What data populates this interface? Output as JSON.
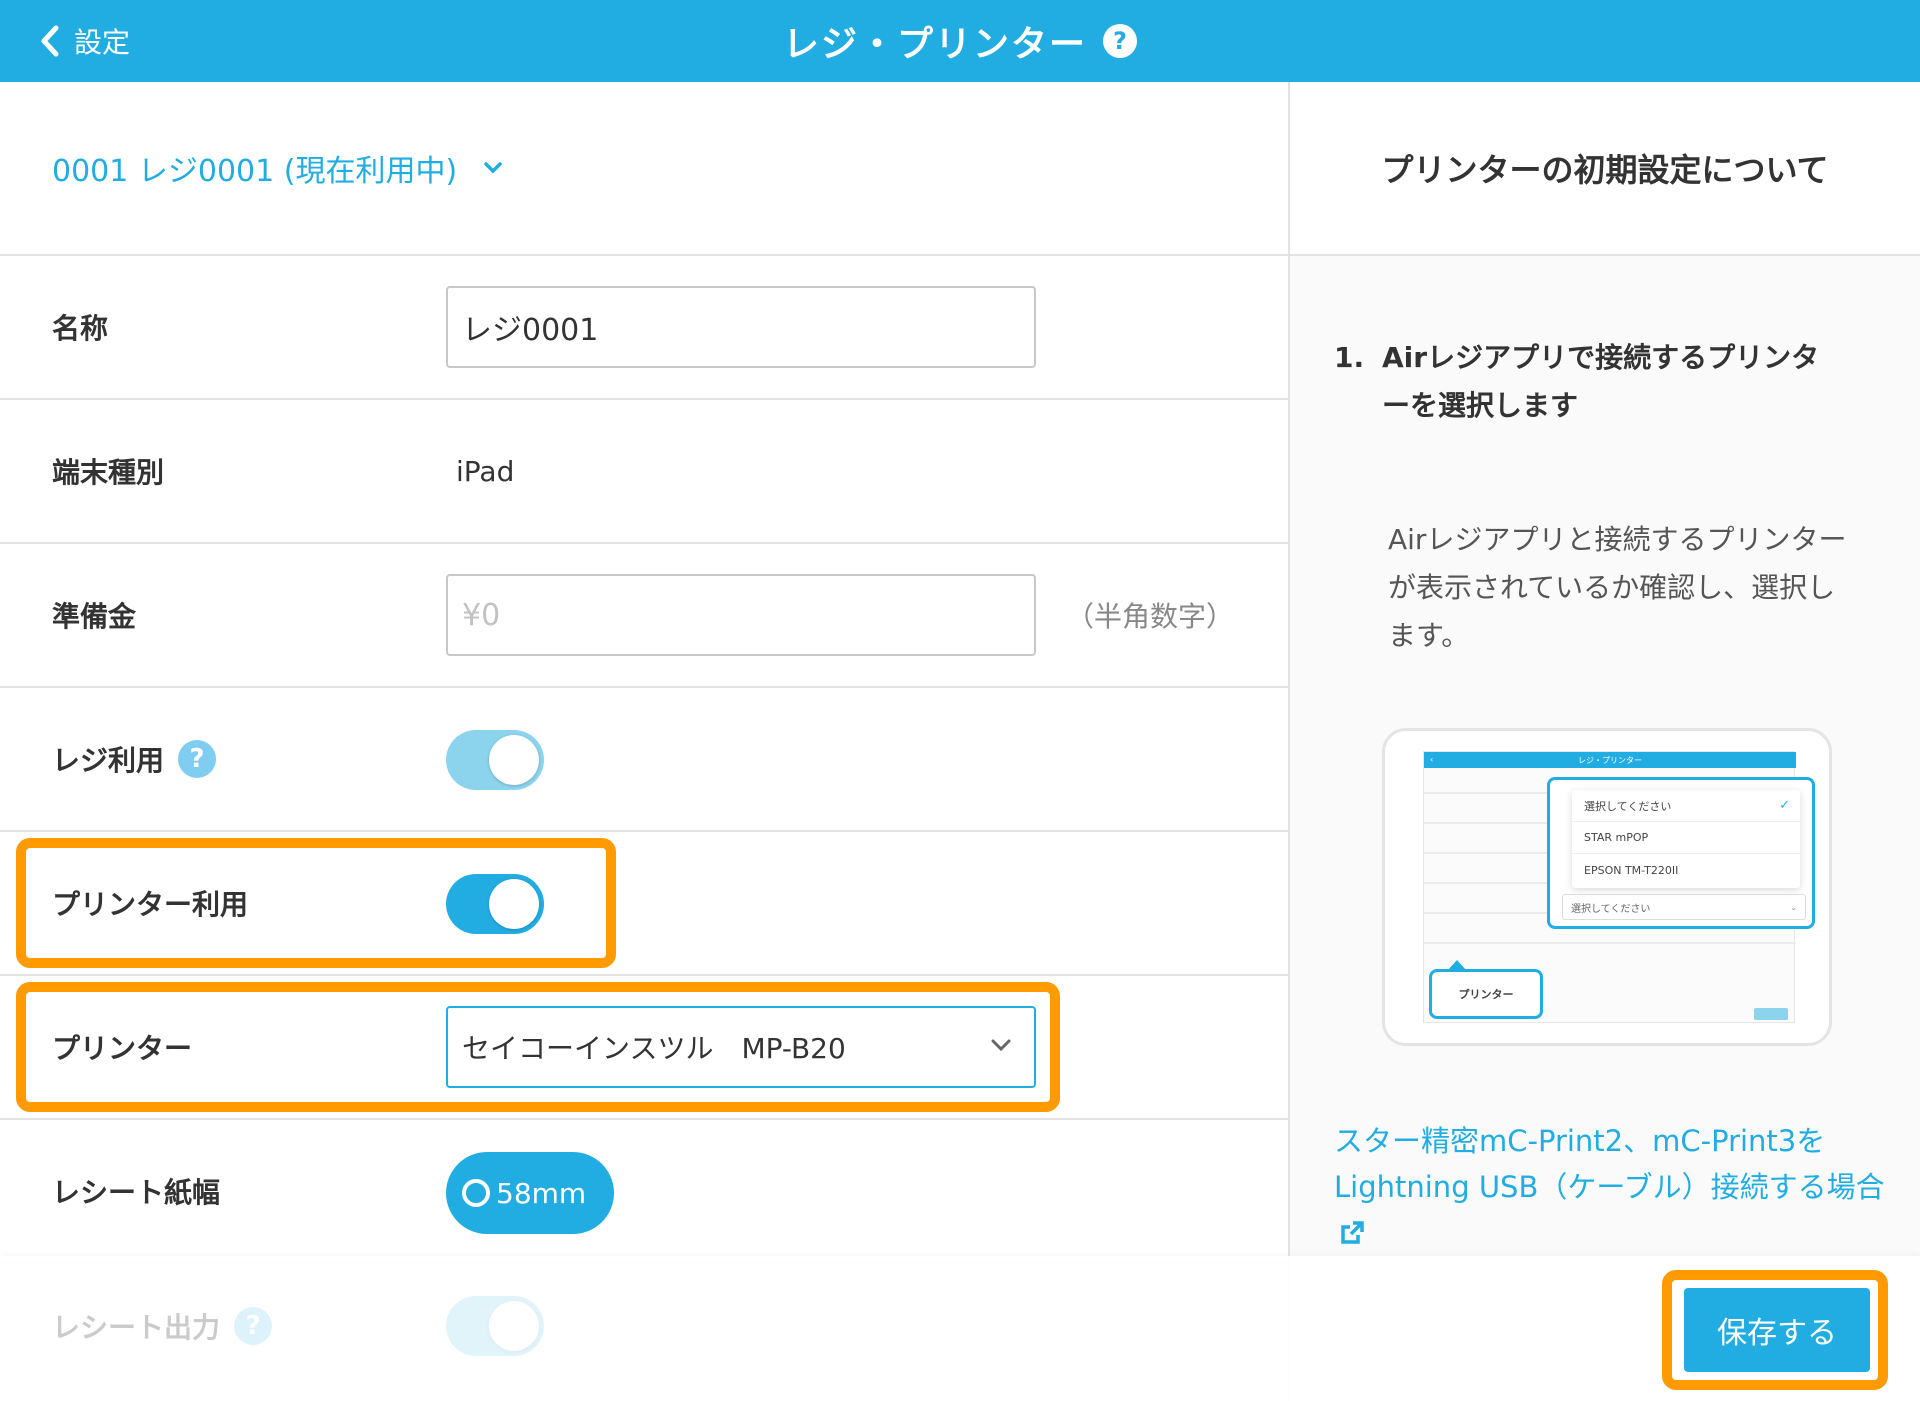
{
  "header": {
    "back_label": "設定",
    "title": "レジ・プリンター",
    "help_label": "?"
  },
  "register_select": {
    "label": "0001 レジ0001 (現在利用中)"
  },
  "form": {
    "name": {
      "label": "名称",
      "value": "レジ0001"
    },
    "device_type": {
      "label": "端末種別",
      "value": "iPad"
    },
    "float_cash": {
      "label": "準備金",
      "placeholder": "¥0",
      "hint": "（半角数字）"
    },
    "register_use": {
      "label": "レジ利用",
      "help": "?",
      "on": true
    },
    "printer_use": {
      "label": "プリンター利用",
      "on": true
    },
    "printer": {
      "label": "プリンター",
      "value": "セイコーインスツル　MP-B20"
    },
    "receipt_width": {
      "label": "レシート紙幅",
      "value": "58mm"
    },
    "receipt_output": {
      "label": "レシート出力",
      "help": "?"
    }
  },
  "right_panel": {
    "title": "プリンターの初期設定について",
    "step_number": "1.",
    "step_title": "Airレジアプリで接続するプリンターを選択します",
    "step_description": "Airレジアプリと接続するプリンターが表示されているか確認し、選択します。",
    "illustration": {
      "bar_title": "レジ・プリンター",
      "options": [
        "選択してください",
        "STAR mPOP",
        "EPSON TM-T220II"
      ],
      "select_placeholder": "選択してください",
      "callout_label": "プリンター"
    },
    "link_text": "スター精密mC-Print2、mC-Print3をLightning USB（ケーブル）接続する場合"
  },
  "footer": {
    "save_label": "保存する"
  },
  "colors": {
    "accent": "#22ade2",
    "highlight": "#ff9a00"
  }
}
